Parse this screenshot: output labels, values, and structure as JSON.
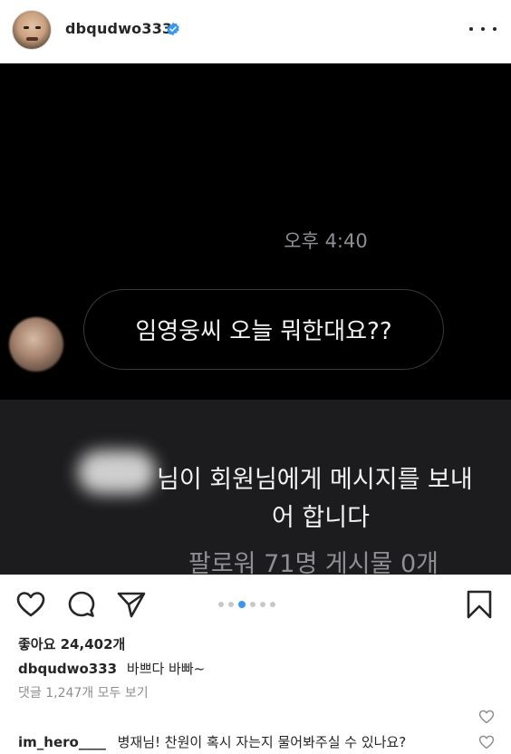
{
  "header": {
    "username": "dbqudwo333",
    "verified_color": "#3897f0"
  },
  "post": {
    "time": "오후 4:40",
    "message": "임영웅씨 오늘 뭐한대요??",
    "request_line1": "님이 회원님에게 메시지를 보내",
    "request_line2": "어 합니다",
    "request_line3": "팔로워 71명 게시물 0개"
  },
  "actions": {
    "icons": [
      "heart-icon",
      "comment-icon",
      "share-icon",
      "bookmark-icon"
    ],
    "carousel_count": 6,
    "carousel_active": 2
  },
  "likes": "좋아요 24,402개",
  "caption": {
    "username": "dbqudwo333",
    "text": "바쁘다 바빠~"
  },
  "view_comments": "댓글 1,247개 모두 보기",
  "comments": [
    {
      "username": "im_hero____",
      "text": "병재님! 찬원이 혹시 자는지 물어봐주실 수 있나요?"
    }
  ],
  "colors": {
    "accent": "#3897f0",
    "text": "#262626",
    "muted": "#8e8e8e"
  }
}
